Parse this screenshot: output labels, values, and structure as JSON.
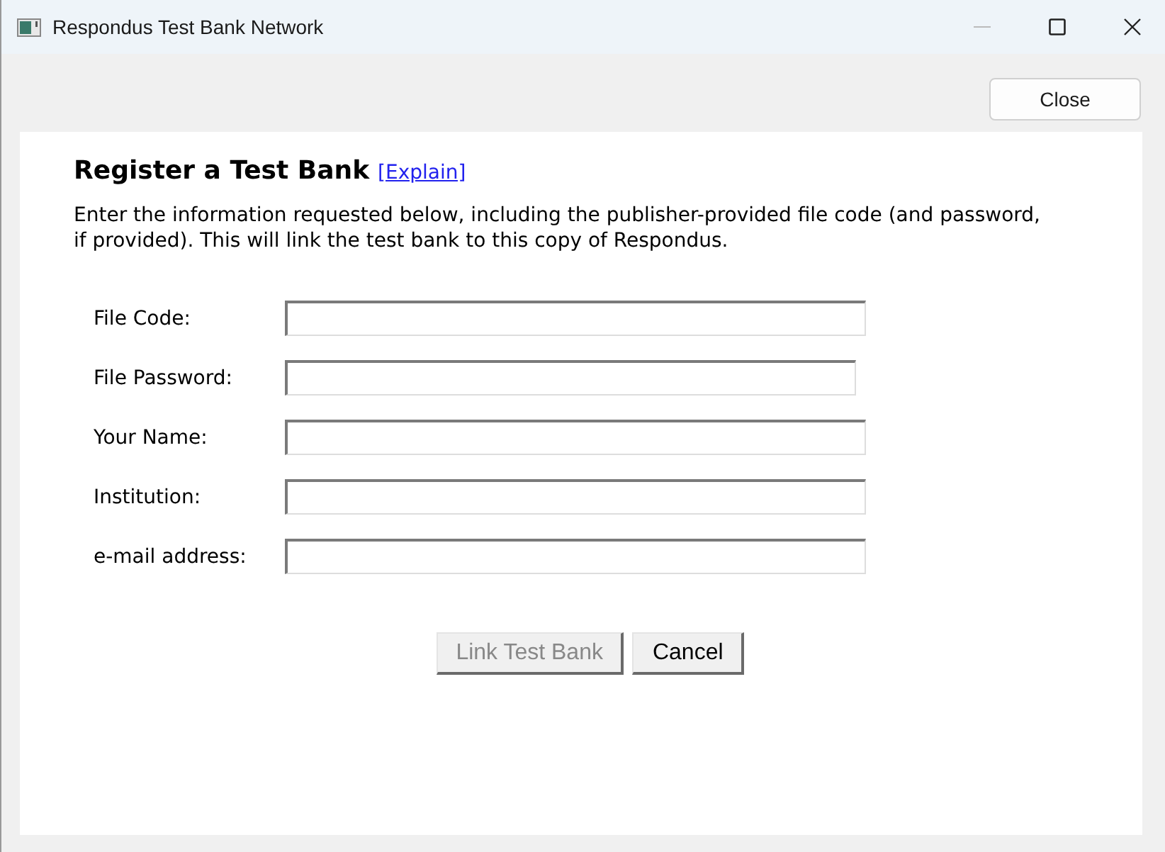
{
  "window": {
    "title": "Respondus Test Bank Network"
  },
  "close_button": {
    "label": "Close"
  },
  "heading": "Register a Test Bank",
  "explain_link": "[Explain]",
  "instructions": "Enter the information requested below, including the publisher-provided file code (and password, if provided). This will link the test bank to this copy of Respondus.",
  "fields": [
    {
      "label": "File Code:",
      "kind": "text"
    },
    {
      "label": "File Password:",
      "kind": "password"
    },
    {
      "label": "Your Name:",
      "kind": "text"
    },
    {
      "label": "Institution:",
      "kind": "text"
    },
    {
      "label": "e-mail address:",
      "kind": "text"
    }
  ],
  "buttons": [
    {
      "label": "Link Test Bank",
      "disabled": true
    },
    {
      "label": "Cancel",
      "disabled": false
    }
  ]
}
